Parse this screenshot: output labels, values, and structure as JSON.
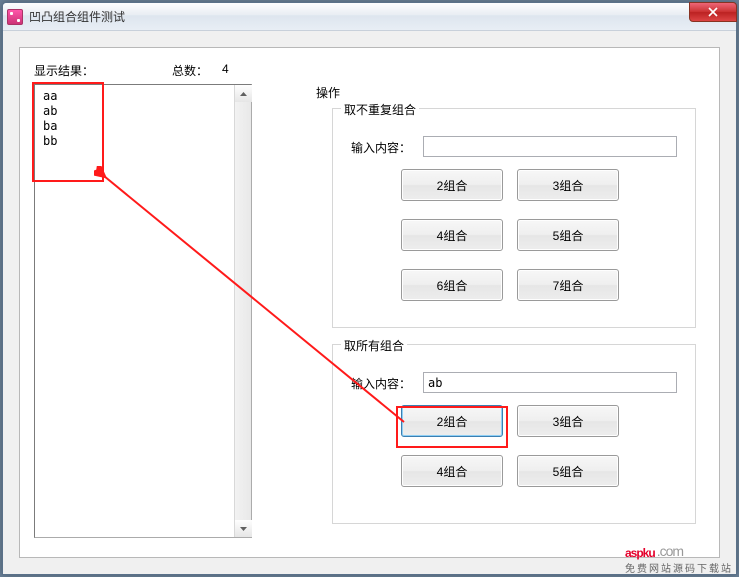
{
  "window": {
    "title": "凹凸组合组件测试"
  },
  "labels": {
    "resultHeader": "显示结果：",
    "totalHeader": "总数：",
    "totalValue": "4",
    "operation": "操作"
  },
  "results": [
    "aa",
    "ab",
    "ba",
    "bb"
  ],
  "group1": {
    "title": "取不重复组合",
    "inputLabel": "输入内容：",
    "inputValue": "",
    "buttons": [
      "2组合",
      "3组合",
      "4组合",
      "5组合",
      "6组合",
      "7组合"
    ]
  },
  "group2": {
    "title": "取所有组合",
    "inputLabel": "输入内容：",
    "inputValue": "ab",
    "buttons": [
      "2组合",
      "3组合",
      "4组合",
      "5组合"
    ]
  },
  "watermark": {
    "brand": "aspku",
    "tld": ".com",
    "tagline": "免费网站源码下载站"
  }
}
